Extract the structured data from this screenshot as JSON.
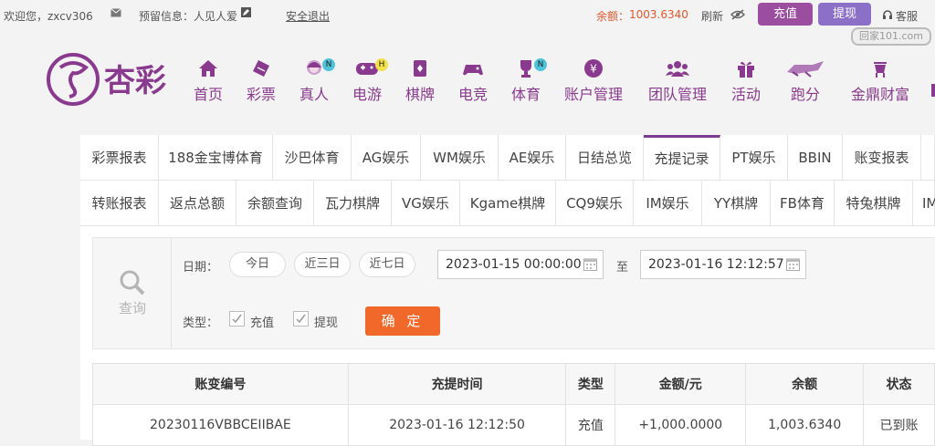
{
  "topbar": {
    "welcome": "欢迎您，zxcv306",
    "reserved": "预留信息：人见人爱",
    "logout": "安全退出",
    "balance_label": "余额：",
    "balance_value": "1003.6340",
    "refresh": "刷新",
    "recharge": "充值",
    "withdraw": "提现",
    "support": "客服",
    "watermark": "回家101.com"
  },
  "logo_text": "杏彩",
  "nav": [
    {
      "label": "首页",
      "icon": "home-icon"
    },
    {
      "label": "彩票",
      "icon": "lottery-icon"
    },
    {
      "label": "真人",
      "icon": "live-dealer-icon",
      "badge": "N"
    },
    {
      "label": "电游",
      "icon": "gamepad-icon",
      "badge": "H"
    },
    {
      "label": "棋牌",
      "icon": "cards-icon"
    },
    {
      "label": "电竞",
      "icon": "esports-icon"
    },
    {
      "label": "体育",
      "icon": "trophy-icon",
      "badge": "N"
    },
    {
      "label": "账户管理",
      "icon": "account-icon"
    },
    {
      "label": "团队管理",
      "icon": "team-icon"
    },
    {
      "label": "活动",
      "icon": "gift-icon"
    },
    {
      "label": "跑分",
      "icon": "run-icon"
    },
    {
      "label": "金鼎财富",
      "icon": "wealth-icon"
    }
  ],
  "tabs_row1": [
    "彩票报表",
    "188金宝博体育",
    "沙巴体育",
    "AG娱乐",
    "WM娱乐",
    "AE娱乐",
    "日结总览",
    "充提记录",
    "PT娱乐",
    "BBIN",
    "账变报表"
  ],
  "tabs_row2": [
    "转账报表",
    "返点总额",
    "余额查询",
    "瓦力棋牌",
    "VG娱乐",
    "Kgame棋牌",
    "CQ9娱乐",
    "IM娱乐",
    "YY棋牌",
    "FB体育",
    "特兔棋牌",
    "IM"
  ],
  "active_tab": "充提记录",
  "query": {
    "search_label": "查询",
    "date_label": "日期：",
    "today": "今日",
    "three_days": "近三日",
    "seven_days": "近七日",
    "start": "2023-01-15 00:00:00",
    "to": "至",
    "end": "2023-01-16 12:12:57",
    "type_label": "类型：",
    "recharge": "充值",
    "withdraw": "提现",
    "confirm": "确 定"
  },
  "table": {
    "headers": [
      "账变编号",
      "充提时间",
      "类型",
      "金额/元",
      "余额",
      "状态"
    ],
    "rows": [
      [
        "20230116VBBCEIIBAE",
        "2023-01-16 12:12:50",
        "充值",
        "+1,000.0000",
        "1,003.6340",
        "已到账"
      ]
    ]
  },
  "colors": {
    "brand": "#8a3a8e",
    "accent": "#f0682a",
    "amount": "#c81e1e",
    "status_ok": "#2f9b2f"
  }
}
